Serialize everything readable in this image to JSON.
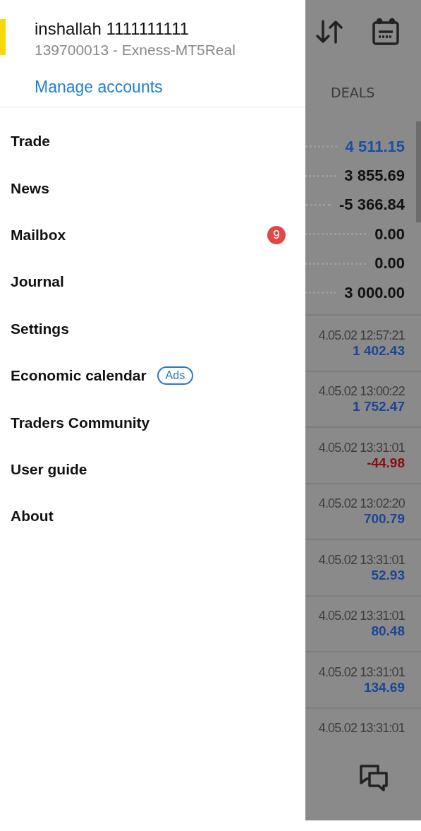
{
  "drawer": {
    "account": {
      "name": "inshallah 1111111111",
      "details": "139700013 - Exness-MT5Real",
      "manage_link": "Manage accounts"
    },
    "menu": [
      {
        "label": "Trade"
      },
      {
        "label": "News"
      },
      {
        "label": "Mailbox",
        "badge": "9"
      },
      {
        "label": "Journal"
      },
      {
        "label": "Settings"
      },
      {
        "label": "Economic calendar",
        "tag": "Ads"
      },
      {
        "label": "Traders Community"
      },
      {
        "label": "User guide"
      },
      {
        "label": "About"
      }
    ]
  },
  "background": {
    "tab": "DEALS",
    "summary": [
      {
        "value": "4 511.15",
        "color": "#1c4fa0"
      },
      {
        "value": "3 855.69",
        "color": "#111111"
      },
      {
        "value": "-5 366.84",
        "color": "#111111"
      },
      {
        "value": "0.00",
        "color": "#111111"
      },
      {
        "value": "0.00",
        "color": "#111111"
      },
      {
        "value": "3 000.00",
        "color": "#111111"
      }
    ],
    "deals": [
      {
        "time": "4.05.02 12:57:21",
        "value": "1 402.43",
        "color": "#1c4596"
      },
      {
        "time": "4.05.02 13:00:22",
        "value": "1 752.47",
        "color": "#1c4596"
      },
      {
        "time": "4.05.02 13:31:01",
        "value": "-44.98",
        "color": "#8b0a0a"
      },
      {
        "time": "4.05.02 13:02:20",
        "value": "700.79",
        "color": "#1c4596"
      },
      {
        "time": "4.05.02 13:31:01",
        "value": "52.93",
        "color": "#1c4596"
      },
      {
        "time": "4.05.02 13:31:01",
        "value": "80.48",
        "color": "#1c4596"
      },
      {
        "time": "4.05.02 13:31:01",
        "value": "134.69",
        "color": "#1c4596"
      },
      {
        "time": "4.05.02 13:31:01"
      }
    ]
  }
}
